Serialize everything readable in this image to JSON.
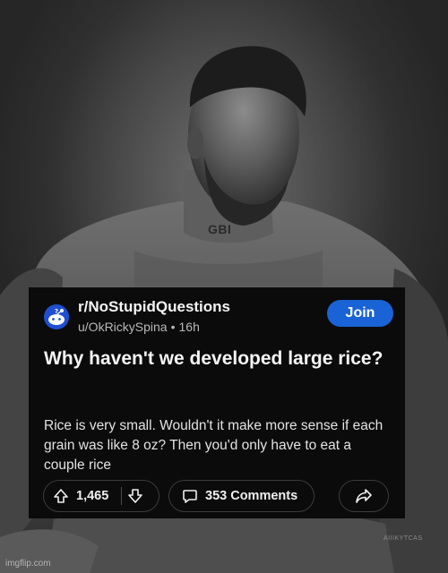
{
  "photo": {
    "shirt_tag": "GBI",
    "signature": "AIIIKYTCAS",
    "watermark": "imgflip.com"
  },
  "post": {
    "community": "r/NoStupidQuestions",
    "author": "u/OkRickySpina",
    "age": "16h",
    "join_label": "Join",
    "title": "Why haven't we developed large rice?",
    "body": "Rice is very small. Wouldn't it make more sense if each grain was like 8 oz? Then you'd only have to eat a couple rice",
    "votes": "1,465",
    "comments": "353 Comments"
  },
  "colors": {
    "card_background": "#0b0b0b",
    "join_button": "#1a63d6",
    "avatar": "#1e4fd0"
  },
  "icons": {
    "upvote": "arrow-up-icon",
    "downvote": "arrow-down-icon",
    "comment": "speech-bubble-icon",
    "share": "share-arrow-icon"
  }
}
